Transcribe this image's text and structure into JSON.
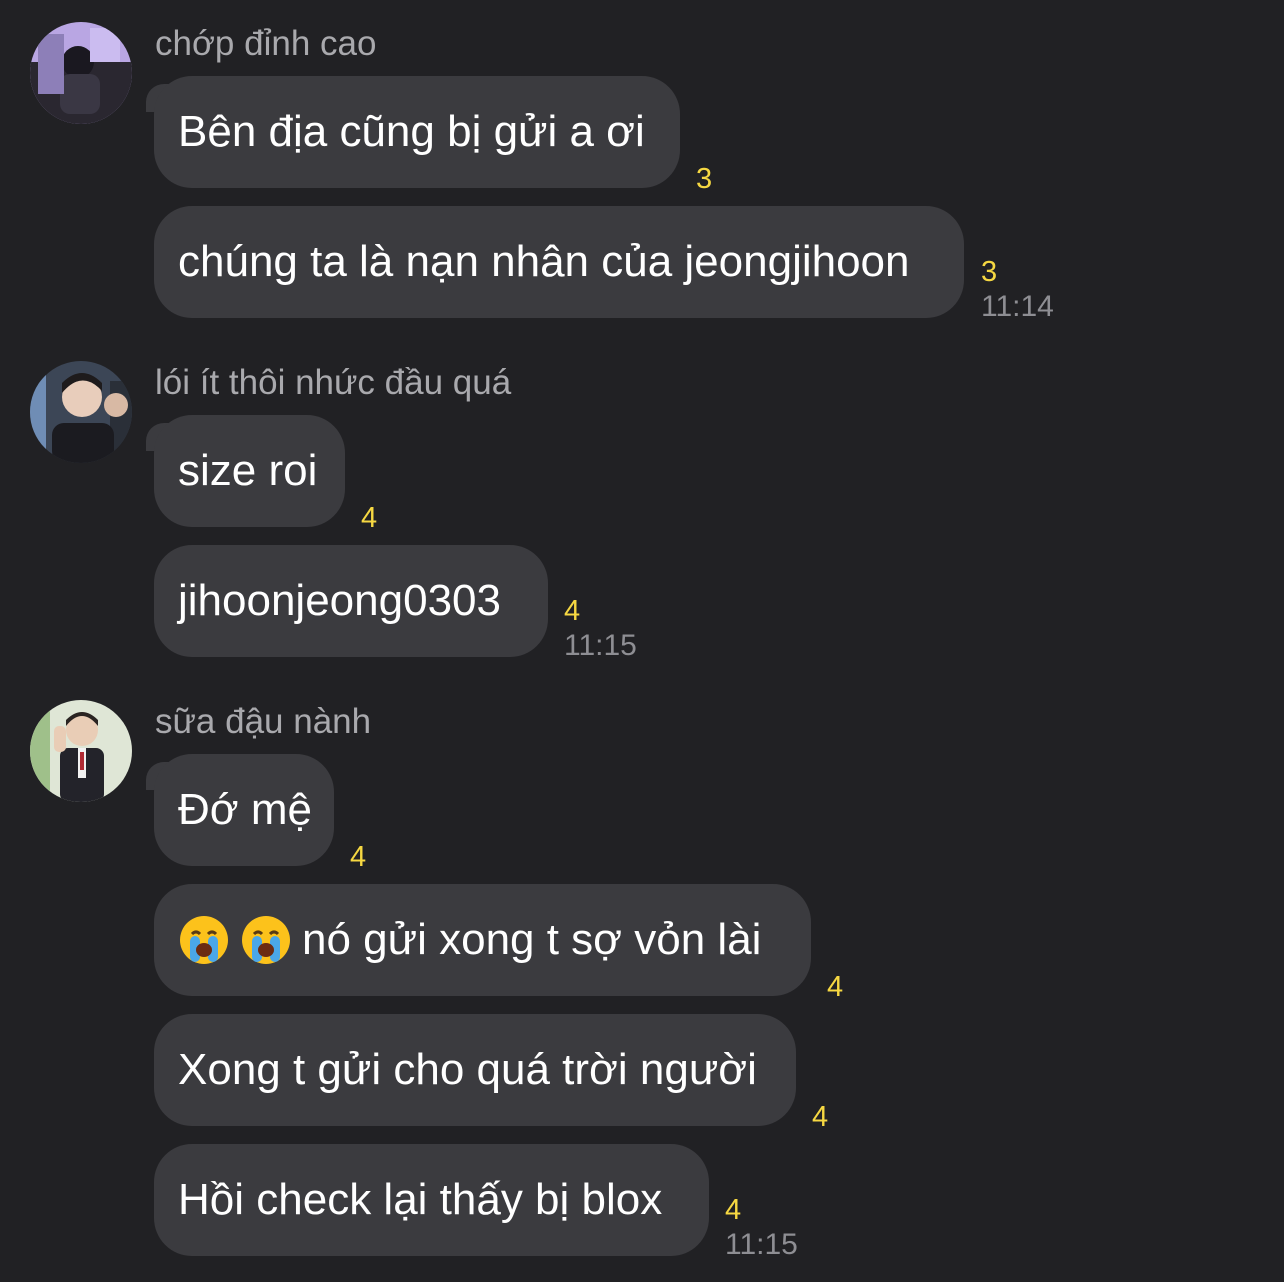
{
  "groups": [
    {
      "sender": "chớp đỉnh cao",
      "messages": [
        {
          "text": "Bên địa cũng bị gửi a ơi",
          "unread": "3"
        },
        {
          "text": "chúng ta là nạn nhân của jeongjihoon",
          "unread": "3",
          "time": "11:14"
        }
      ]
    },
    {
      "sender": "lói ít thôi nhức đầu quá",
      "messages": [
        {
          "text": "size roi",
          "unread": "4"
        },
        {
          "text": "jihoonjeong0303",
          "unread": "4",
          "time": "11:15"
        }
      ]
    },
    {
      "sender": "sữa đậu nành",
      "messages": [
        {
          "text": "Đớ mệ",
          "unread": "4"
        },
        {
          "text": "nó gửi xong t sợ vỏn lài",
          "emoji": [
            "loudly-crying-face",
            "loudly-crying-face"
          ],
          "unread": "4"
        },
        {
          "text": "Xong t gửi cho quá trời người",
          "unread": "4"
        },
        {
          "text": "Hồi check lại thấy bị blox",
          "unread": "4",
          "time": "11:15"
        }
      ]
    }
  ],
  "colors": {
    "background": "#212124",
    "bubble": "#3b3b3f",
    "sender": "#a9a9ad",
    "unread": "#f6d842",
    "time": "#8e8e93"
  }
}
